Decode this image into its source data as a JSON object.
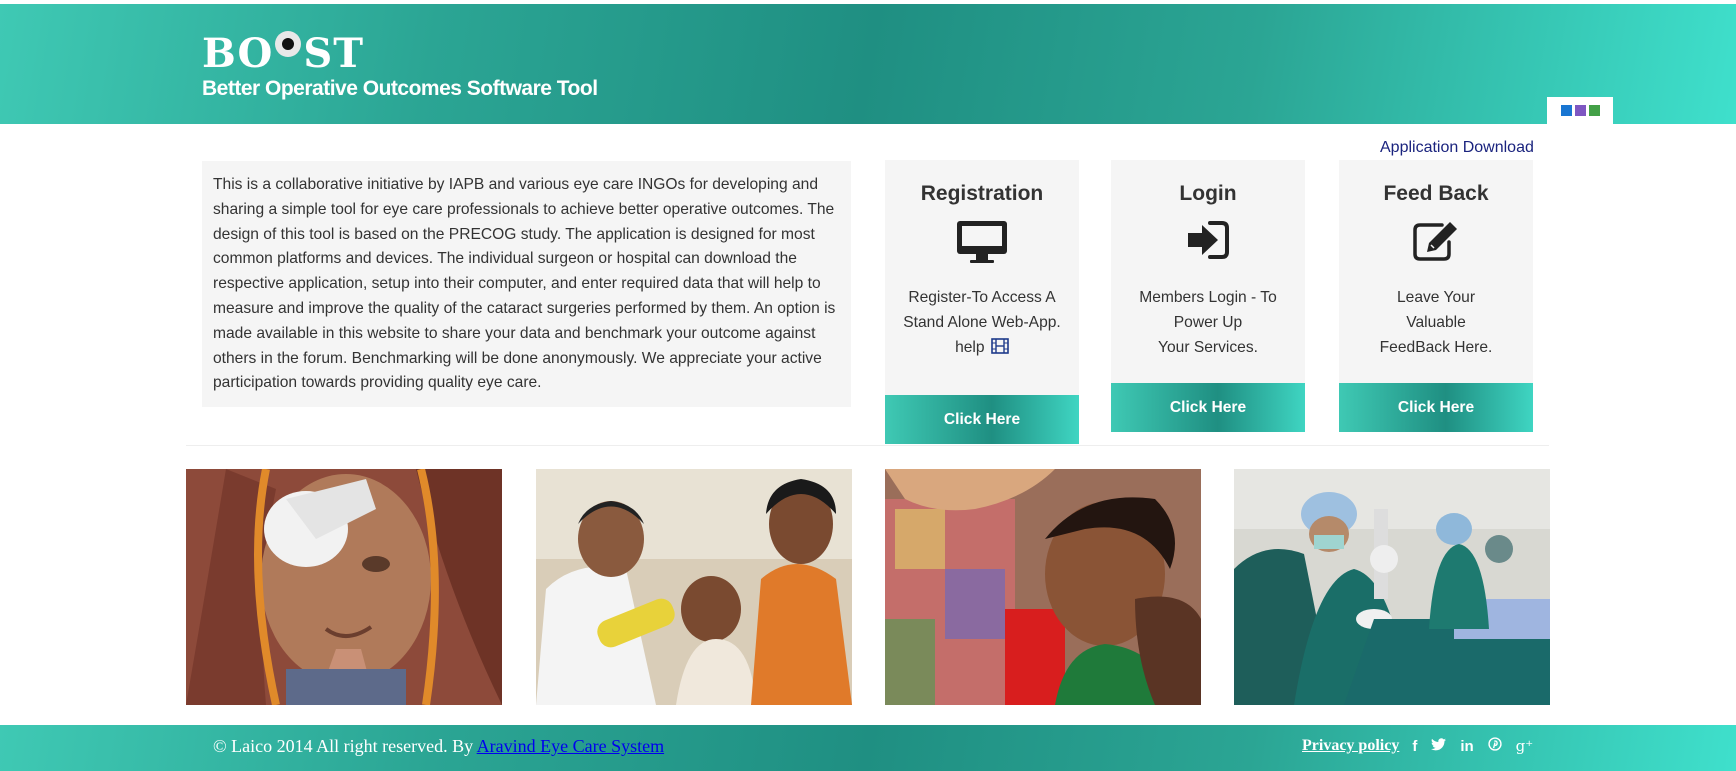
{
  "header": {
    "logo_text_before": "BO",
    "logo_text_after": "ST",
    "tagline": "Better Operative Outcomes Software Tool",
    "swatches": [
      "#1976d2",
      "#7e57c2",
      "#43a047"
    ]
  },
  "app_download_label": "Application Download",
  "intro_text": "This is a collaborative initiative by IAPB and various eye care INGOs for developing and sharing a simple tool for eye care professionals to achieve better operative outcomes. The design of this tool is based on the PRECOG study. The application is designed for most common platforms and devices. The individual surgeon or hospital can download the respective application, setup into their computer, and enter required data that will help to measure and improve the quality of the cataract surgeries performed by them. An option is made available in this website to share your data and benchmark your outcome against others in the forum. Benchmarking will be done anonymously. We appreciate your active participation towards providing quality eye care.",
  "cards": [
    {
      "title": "Registration",
      "icon": "monitor-icon",
      "line1": "Register-To Access A",
      "line2": "Stand Alone Web-App.",
      "line3": "help",
      "button": "Click Here"
    },
    {
      "title": "Login",
      "icon": "sign-in-icon",
      "line1": "Members Login - To",
      "line2": "Power Up",
      "line3": "Your Services.",
      "button": "Click Here"
    },
    {
      "title": "Feed Back",
      "icon": "edit-icon",
      "line1": "Leave Your",
      "line2": "Valuable",
      "line3": "FeedBack Here.",
      "button": "Click Here"
    }
  ],
  "photos": [
    {
      "icon": "elderly-woman-eye-patch-photo"
    },
    {
      "icon": "doctor-examining-child-photo"
    },
    {
      "icon": "child-eye-exam-photo"
    },
    {
      "icon": "surgeons-operating-photo"
    }
  ],
  "footer": {
    "copyright_prefix": "© Laico 2014 All right reserved. By",
    "company_link": "Aravind Eye Care System",
    "privacy_link": "Privacy policy",
    "social": {
      "facebook": "f",
      "twitter": "🐦",
      "linkedin": "in",
      "pinterest": "℗",
      "googleplus": "g⁺"
    }
  },
  "colors": {
    "teal_light": "#3fc9b4",
    "teal_dark": "#1f8f82",
    "link_dark": "#1a237e"
  }
}
